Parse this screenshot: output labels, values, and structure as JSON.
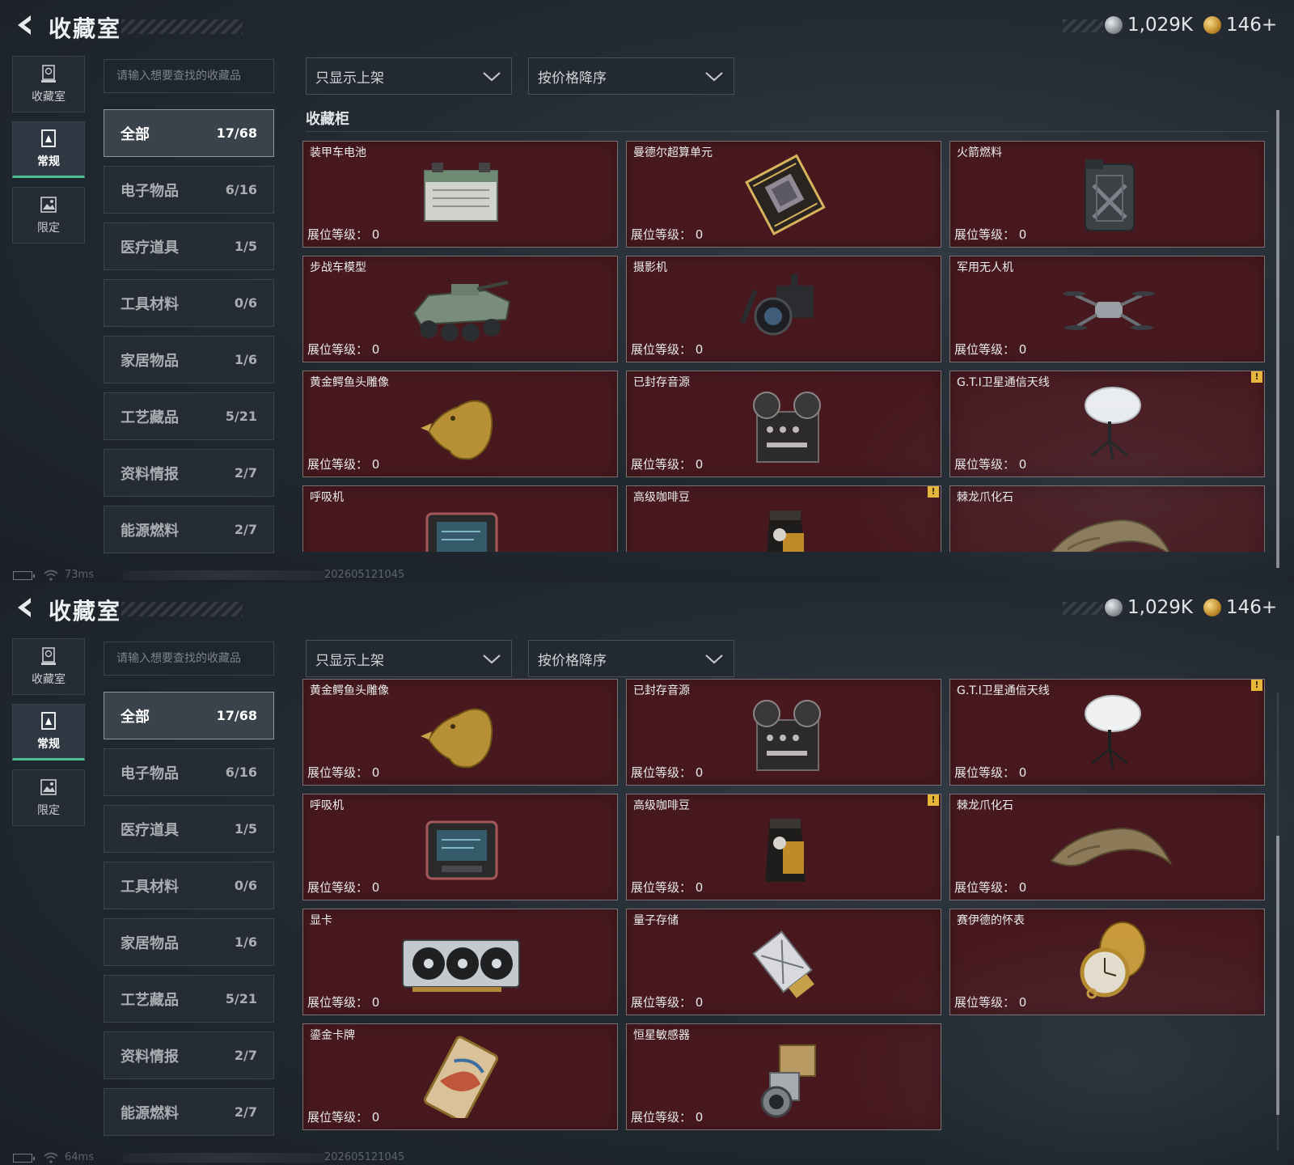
{
  "colors": {
    "accent": "#49c18f",
    "card_bg": "#47191f",
    "badge": "#e7b73a"
  },
  "header": {
    "title": "收藏室",
    "silver": "1,029K",
    "gold": "146+"
  },
  "rail": [
    {
      "label": "收藏室",
      "icon": "trophy-icon"
    },
    {
      "label": "常规",
      "icon": "document-icon"
    },
    {
      "label": "限定",
      "icon": "picture-icon"
    }
  ],
  "search": {
    "placeholder": "请输入想要查找的收藏品"
  },
  "filter": {
    "selected": "只显示上架"
  },
  "sort": {
    "selected": "按价格降序"
  },
  "categories": [
    {
      "name": "全部",
      "count": "17/68"
    },
    {
      "name": "电子物品",
      "count": "6/16"
    },
    {
      "name": "医疗道具",
      "count": "1/5"
    },
    {
      "name": "工具材料",
      "count": "0/6"
    },
    {
      "name": "家居物品",
      "count": "1/6"
    },
    {
      "name": "工艺藏品",
      "count": "5/21"
    },
    {
      "name": "资料情报",
      "count": "2/7"
    },
    {
      "name": "能源燃料",
      "count": "2/7"
    }
  ],
  "section_title": "收藏柜",
  "level_label": "展位等级：",
  "items": [
    {
      "name": "装甲车电池",
      "level": "0",
      "icon": "battery-icon"
    },
    {
      "name": "曼德尔超算单元",
      "level": "0",
      "icon": "processor-icon"
    },
    {
      "name": "火箭燃料",
      "level": "0",
      "icon": "fuel-canister-icon"
    },
    {
      "name": "步战车模型",
      "level": "0",
      "icon": "armored-vehicle-icon"
    },
    {
      "name": "摄影机",
      "level": "0",
      "icon": "camera-icon"
    },
    {
      "name": "军用无人机",
      "level": "0",
      "icon": "drone-icon"
    },
    {
      "name": "黄金鳄鱼头雕像",
      "level": "0",
      "icon": "golden-statue-icon"
    },
    {
      "name": "已封存音源",
      "level": "0",
      "icon": "reel-recorder-icon"
    },
    {
      "name": "G.T.I卫星通信天线",
      "level": "0",
      "icon": "satellite-dish-icon",
      "badge": "!"
    },
    {
      "name": "呼吸机",
      "level": "0",
      "icon": "ventilator-icon"
    },
    {
      "name": "高级咖啡豆",
      "level": "0",
      "icon": "coffee-bag-icon",
      "badge": "!"
    },
    {
      "name": "棘龙爪化石",
      "level": "0",
      "icon": "claw-fossil-icon"
    },
    {
      "name": "显卡",
      "level": "0",
      "icon": "graphics-card-icon"
    },
    {
      "name": "量子存储",
      "level": "0",
      "icon": "usb-drive-icon"
    },
    {
      "name": "赛伊德的怀表",
      "level": "0",
      "icon": "pocket-watch-icon"
    },
    {
      "name": "鎏金卡牌",
      "level": "0",
      "icon": "gold-card-icon"
    },
    {
      "name": "恒星敏感器",
      "level": "0",
      "icon": "star-sensor-icon"
    }
  ],
  "screens": [
    {
      "ping": "73ms",
      "build": "202605121045"
    },
    {
      "ping": "64ms",
      "build": "202605121045"
    }
  ]
}
